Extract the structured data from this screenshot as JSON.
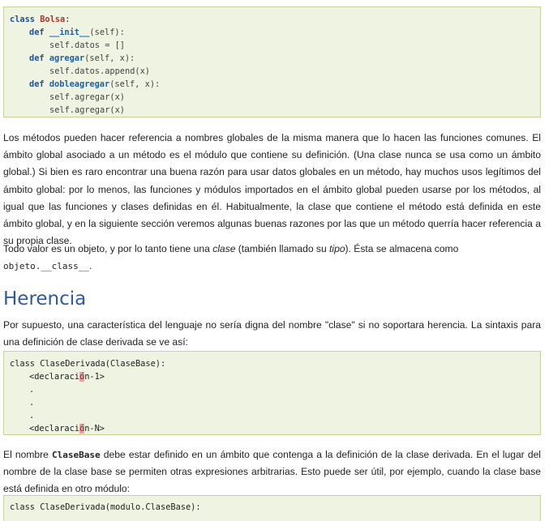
{
  "code1": {
    "kw_class": "class",
    "class_name": "Bolsa",
    "colon": ":",
    "kw_def": "def",
    "init_name": "__init__",
    "init_args": "(self):",
    "init_body": "self.datos = []",
    "agregar_name": "agregar",
    "agregar_args": "(self, x):",
    "agregar_body": "self.datos.append(x)",
    "doble_name": "dobleagregar",
    "doble_args": "(self, x):",
    "doble_body1": "self.agregar(x)",
    "doble_body2": "self.agregar(x)"
  },
  "para1": "Los métodos pueden hacer referencia a nombres globales de la misma manera que lo hacen las funciones comunes. El ámbito global asociado a un método es el módulo que contiene su definición. (Una clase nunca se usa como un ámbito global.) Si bien es raro encontrar una buena razón para usar datos globales en un método, hay muchos usos legítimos del ámbito global: por lo menos, las funciones y módulos importados en el ámbito global pueden usarse por los métodos, al igual que las funciones y clases definidas en él. Habitualmente, la clase que contiene el método está definida en este ámbito global, y en la siguiente sección veremos algunas buenas razones por las que un método querría hacer referencia a su propia clase.",
  "para2": {
    "t1": "Todo valor es un objeto, y por lo tanto tiene una ",
    "clase": "clase",
    "t2": " (también llamado su ",
    "tipo": "tipo",
    "t3": "). Ésta se almacena como",
    "code": "objeto.__class__",
    "t4": "."
  },
  "heading": "Herencia",
  "para3": "Por supuesto, una característica del lenguaje no sería digna del nombre \"clase\" si no soportara herencia. La sintaxis para una definición de clase derivada se ve así:",
  "code2": {
    "line1": "class ClaseDerivada(ClaseBase):",
    "decl_a": "<declaraci",
    "err_char": "ó",
    "decl1_b": "n-1>",
    "dot": ".",
    "declN_b": "n-N>"
  },
  "para4": {
    "t1": "El nombre ",
    "code": "ClaseBase",
    "t2": "  debe estar definido en un ámbito que contenga a la definición de la clase derivada. En el lugar del nombre de la clase base se permiten otras expresiones arbitrarias. Esto puede ser útil, por ejemplo, cuando la clase base está definida en otro módulo:"
  },
  "code3": "class ClaseDerivada(modulo.ClaseBase):"
}
